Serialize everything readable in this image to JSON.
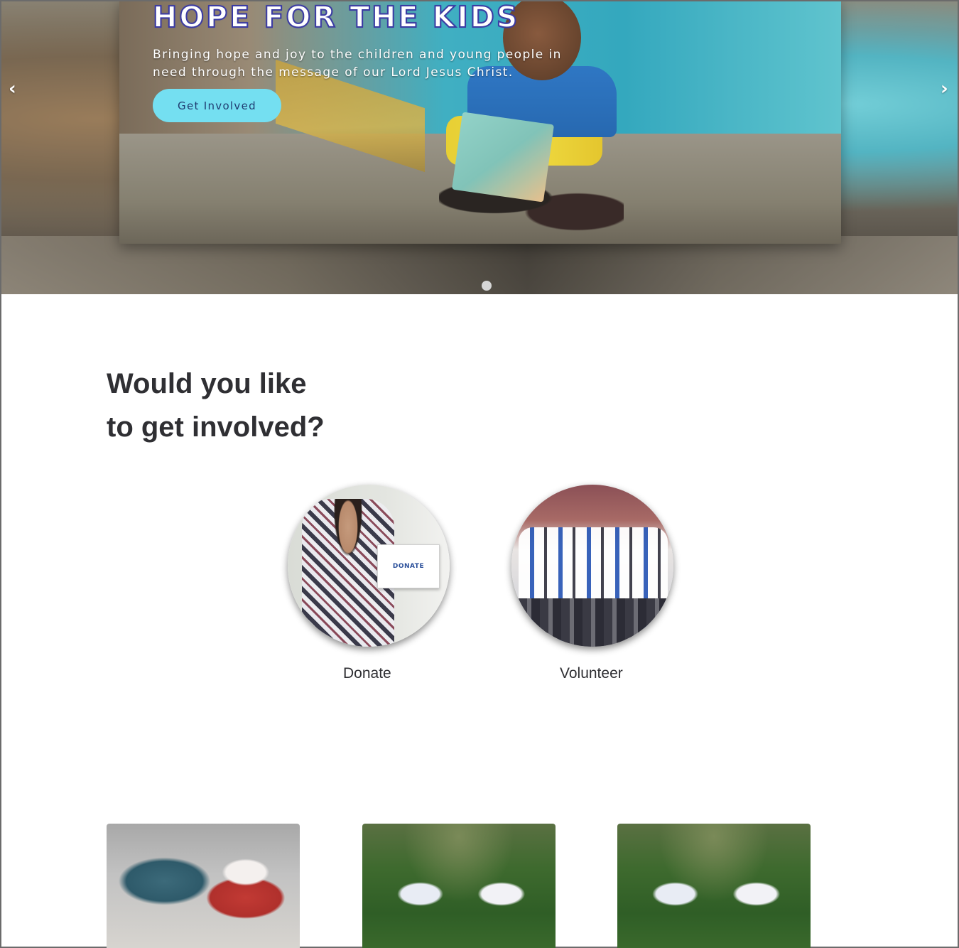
{
  "hero": {
    "title": "HOPE FOR THE KIDS",
    "subtitle": "Bringing hope and joy to the children and young people in need through the message of our Lord Jesus Christ.",
    "cta_label": "Get Involved",
    "prev_arrow": "‹",
    "next_arrow": "›",
    "slide_count": 1,
    "active_slide": 1
  },
  "involved": {
    "heading_line1": "Would you like",
    "heading_line2": "to get involved?",
    "options": [
      {
        "label": "Donate",
        "box_text": "DONATE"
      },
      {
        "label": "Volunteer"
      }
    ]
  },
  "colors": {
    "cta_background": "#6fe0f3",
    "cta_text": "#1f3c74",
    "title_outline": "#3a3aa8",
    "heading_text": "#2f2f33"
  }
}
